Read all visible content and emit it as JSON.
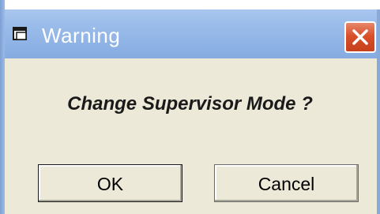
{
  "window": {
    "title": "Warning",
    "title_icon": "window-icon",
    "close_icon": "close-icon"
  },
  "message": "Change Supervisor Mode ?",
  "buttons": {
    "ok_label": "OK",
    "cancel_label": "Cancel"
  },
  "colors": {
    "titlebar": "#9bbdea",
    "dialog_background": "#ece9d8",
    "close_button": "#d8512b"
  }
}
